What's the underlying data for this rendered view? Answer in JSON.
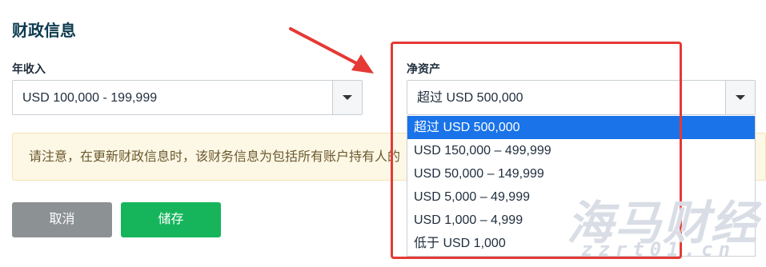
{
  "section": {
    "title": "财政信息"
  },
  "annual_income": {
    "label": "年收入",
    "selected_value": "USD 100,000 - 199,999"
  },
  "net_worth": {
    "label": "净资产",
    "selected_value": "超过 USD 500,000",
    "options": [
      "超过 USD 500,000",
      "USD 150,000 – 499,999",
      "USD 50,000 – 149,999",
      "USD 5,000 – 49,999",
      "USD 1,000 – 4,999",
      "低于 USD 1,000"
    ]
  },
  "notice": {
    "text": "请注意，在更新财政信息时，该财务信息为包括所有账户持有人的"
  },
  "buttons": {
    "cancel": "取消",
    "save": "储存"
  },
  "watermark": {
    "cn": "海马财经",
    "en": "zzrt01.cn"
  },
  "colors": {
    "annotation_red": "#e53935",
    "selected_option": "#1a73e8",
    "save_button": "#16b55c",
    "cancel_button": "#8c9194",
    "title": "#0d3b4f",
    "notice_bg": "#fdf7e6"
  }
}
